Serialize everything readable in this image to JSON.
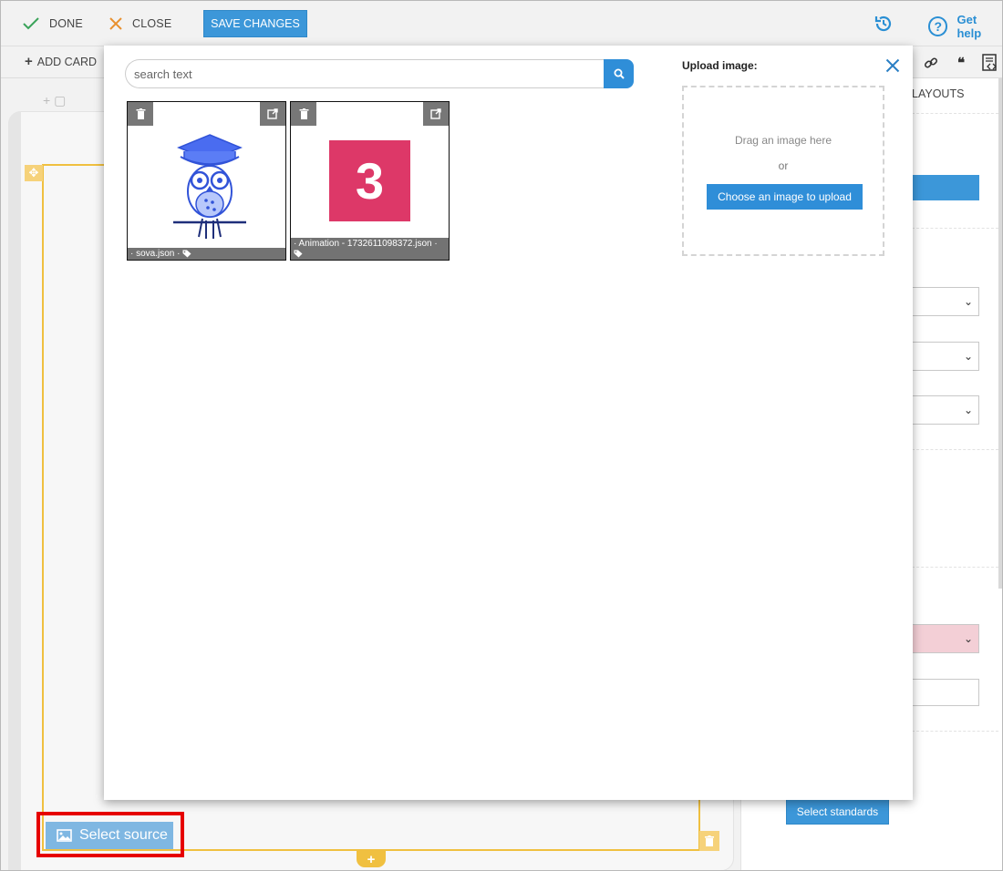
{
  "toolbar": {
    "done_label": "DONE",
    "close_label": "CLOSE",
    "save_label": "SAVE CHANGES",
    "help_label": "Get help"
  },
  "toolbar2": {
    "add_card_label": "ADD CARD"
  },
  "right_panel": {
    "layouts_tab": "LAYOUTS",
    "select_standards_label": "Select standards"
  },
  "canvas": {
    "select_source_label": "Select source"
  },
  "modal": {
    "search": {
      "placeholder": "search text"
    },
    "images": [
      {
        "caption": "· sova.json ·"
      },
      {
        "caption": "· Animation - 1732611098372.json ·",
        "tile_text": "3"
      }
    ],
    "upload": {
      "title": "Upload image:",
      "drag_text": "Drag an image here",
      "or_text": "or",
      "button_label": "Choose an image to upload"
    }
  },
  "colors": {
    "accent": "#3c97d9",
    "tile_pink": "#dd3868",
    "highlight_red": "#e60000",
    "guide_yellow": "#f0c040"
  }
}
